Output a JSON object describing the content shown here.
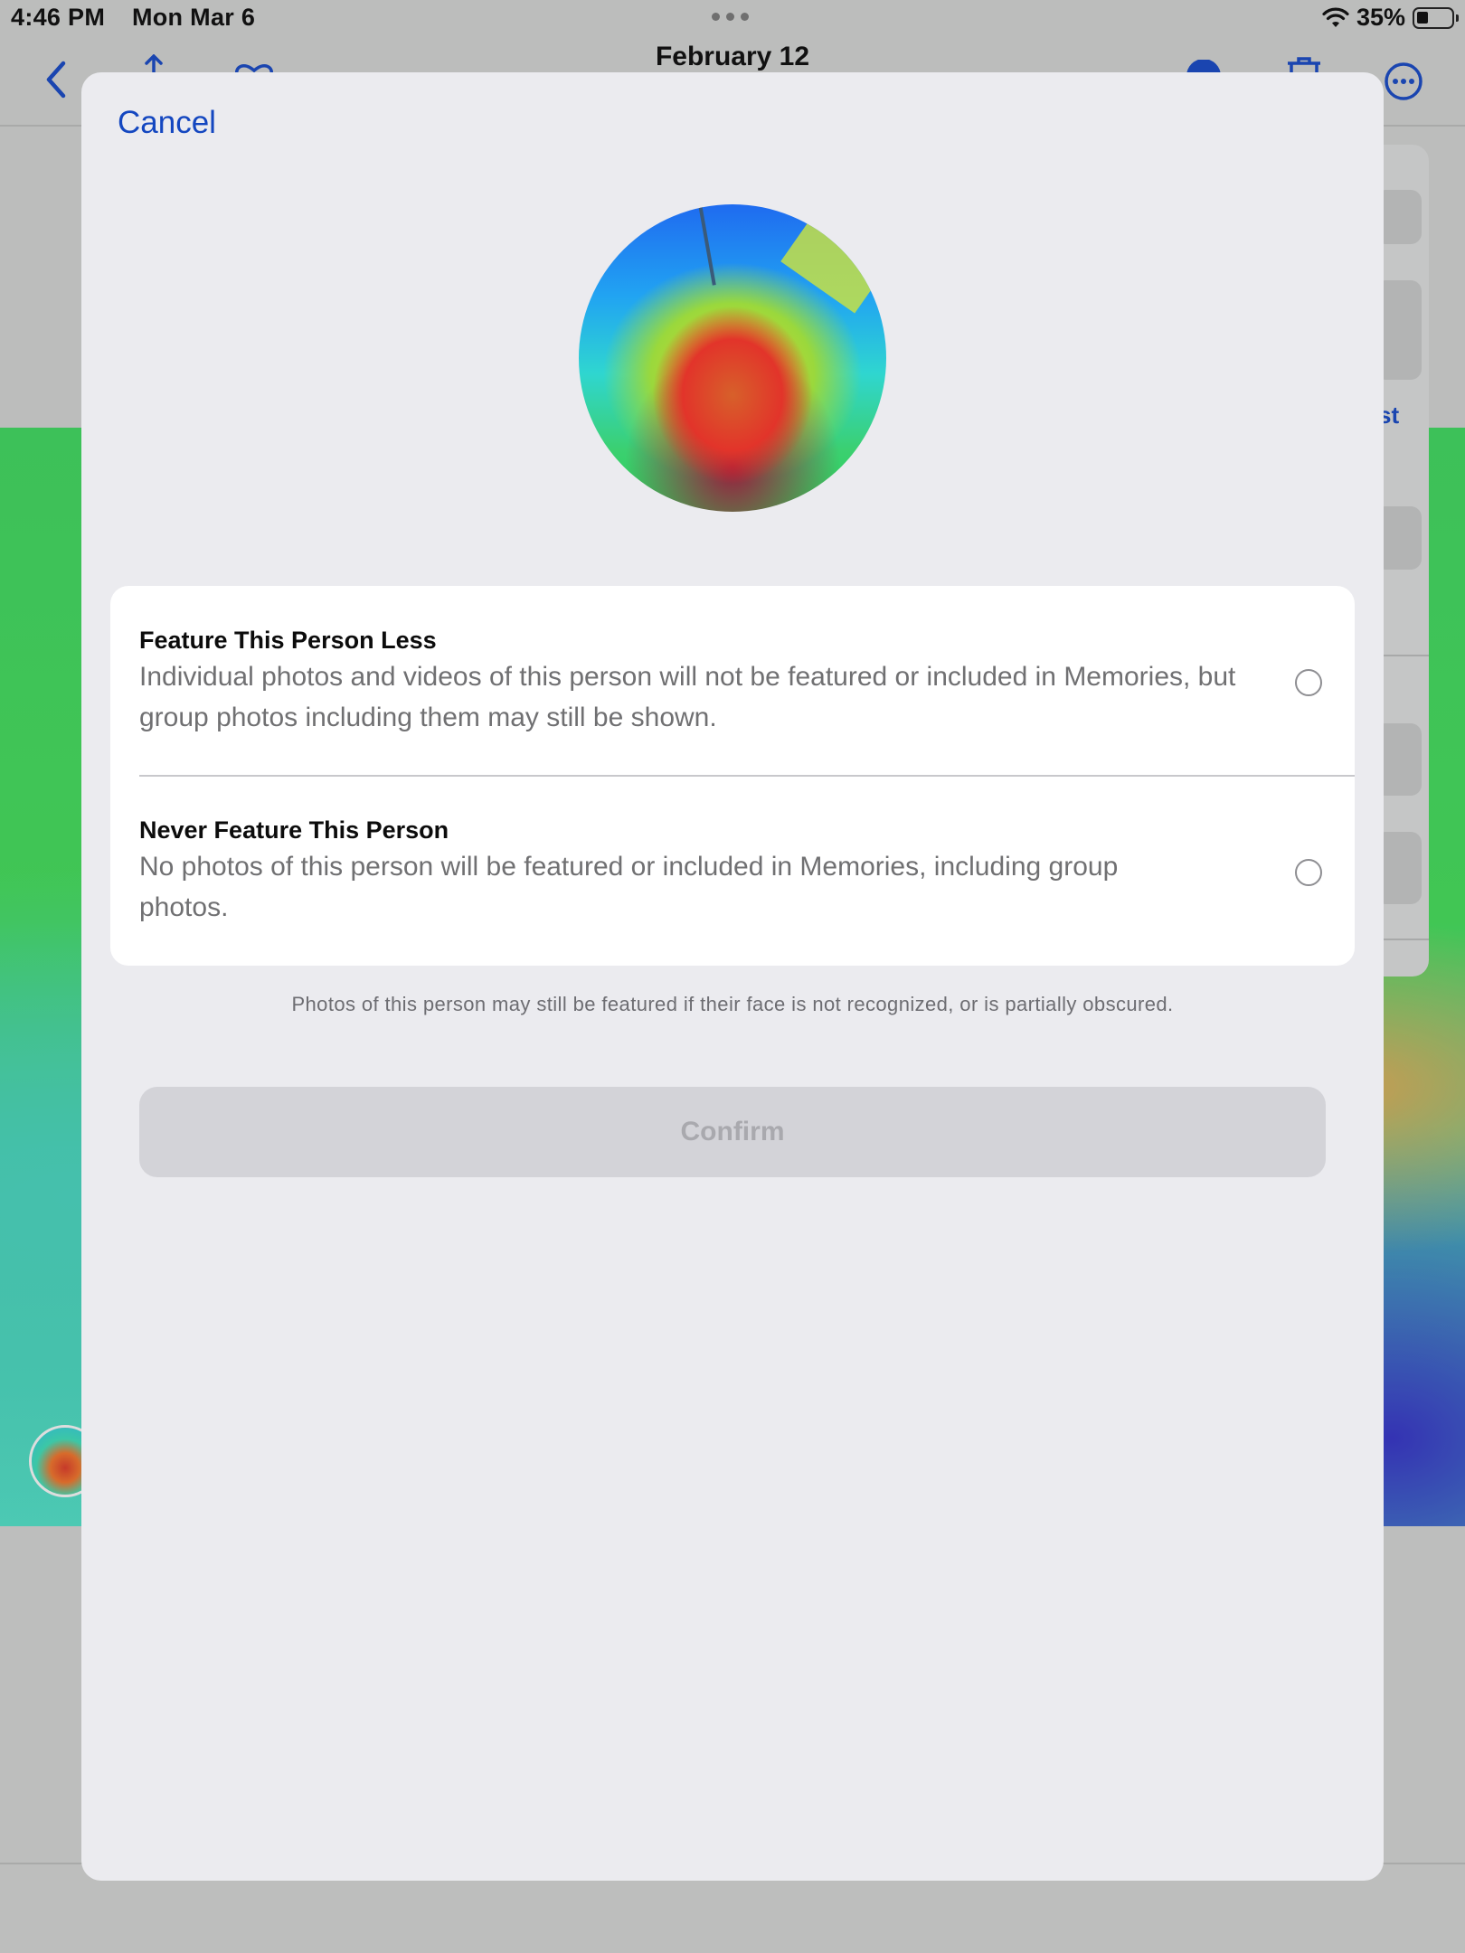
{
  "status_bar": {
    "time": "4:46 PM",
    "date": "Mon Mar 6",
    "battery": "35%",
    "battery_level": 0.35
  },
  "background_nav": {
    "title": "February 12",
    "partial_side_text": "st"
  },
  "sheet": {
    "cancel_label": "Cancel",
    "options": [
      {
        "title": "Feature This Person Less",
        "description": "Individual photos and videos of this person will not be featured or included in Memories, but group photos including them may still be shown.",
        "selected": false
      },
      {
        "title": "Never Feature This Person",
        "description": "No photos of this person will be featured or included in Memories, including group photos.",
        "selected": false
      }
    ],
    "footnote": "Photos of this person may still be featured if their face is not recognized, or is partially obscured.",
    "confirm_label": "Confirm",
    "confirm_enabled": false
  },
  "colors": {
    "accent": "#1447c0",
    "sheet_bg": "#ebebef",
    "disabled_button": "#d3d3d8",
    "disabled_text": "#a9a9ae"
  },
  "icons": [
    "back-chevron-icon",
    "share-icon",
    "heart-icon",
    "info-icon",
    "trash-icon",
    "more-icon",
    "wifi-icon",
    "battery-icon"
  ]
}
